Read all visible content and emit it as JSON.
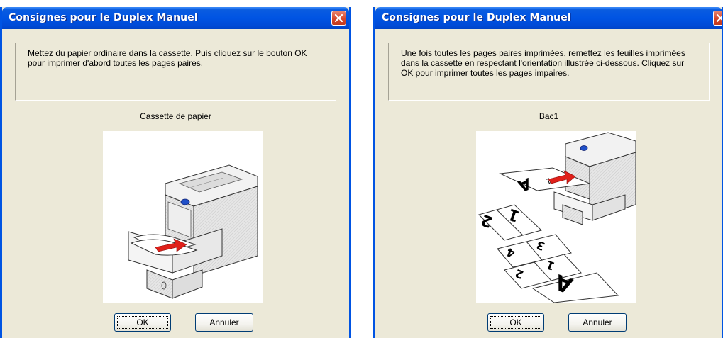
{
  "dialog1": {
    "title": "Consignes pour le Duplex Manuel",
    "message": "Mettez du papier ordinaire dans la cassette. Puis cliquez sur le bouton OK\npour imprimer d'abord toutes les pages paires.",
    "caption": "Cassette de papier",
    "ok_label": "OK",
    "cancel_label": "Annuler"
  },
  "dialog2": {
    "title": "Consignes pour le Duplex Manuel",
    "message": "Une fois toutes les pages paires imprimées, remettez les feuilles imprimées\ndans la cassette en respectant l'orientation illustrée ci-dessous. Cliquez sur\nOK pour imprimer toutes les pages impaires.",
    "caption": "Bac1",
    "ok_label": "OK",
    "cancel_label": "Annuler",
    "page_labels": [
      "A",
      "1",
      "2",
      "3",
      "4",
      "A"
    ]
  },
  "colors": {
    "titlebar": "#0054E3",
    "dialog_bg": "#ECE9D8",
    "close_button": "#D6472B",
    "arrow": "#E0201A",
    "printer_button": "#2050C8"
  },
  "icons": [
    "close-icon",
    "printer-cassette-illustration",
    "printer-tray-illustration"
  ]
}
